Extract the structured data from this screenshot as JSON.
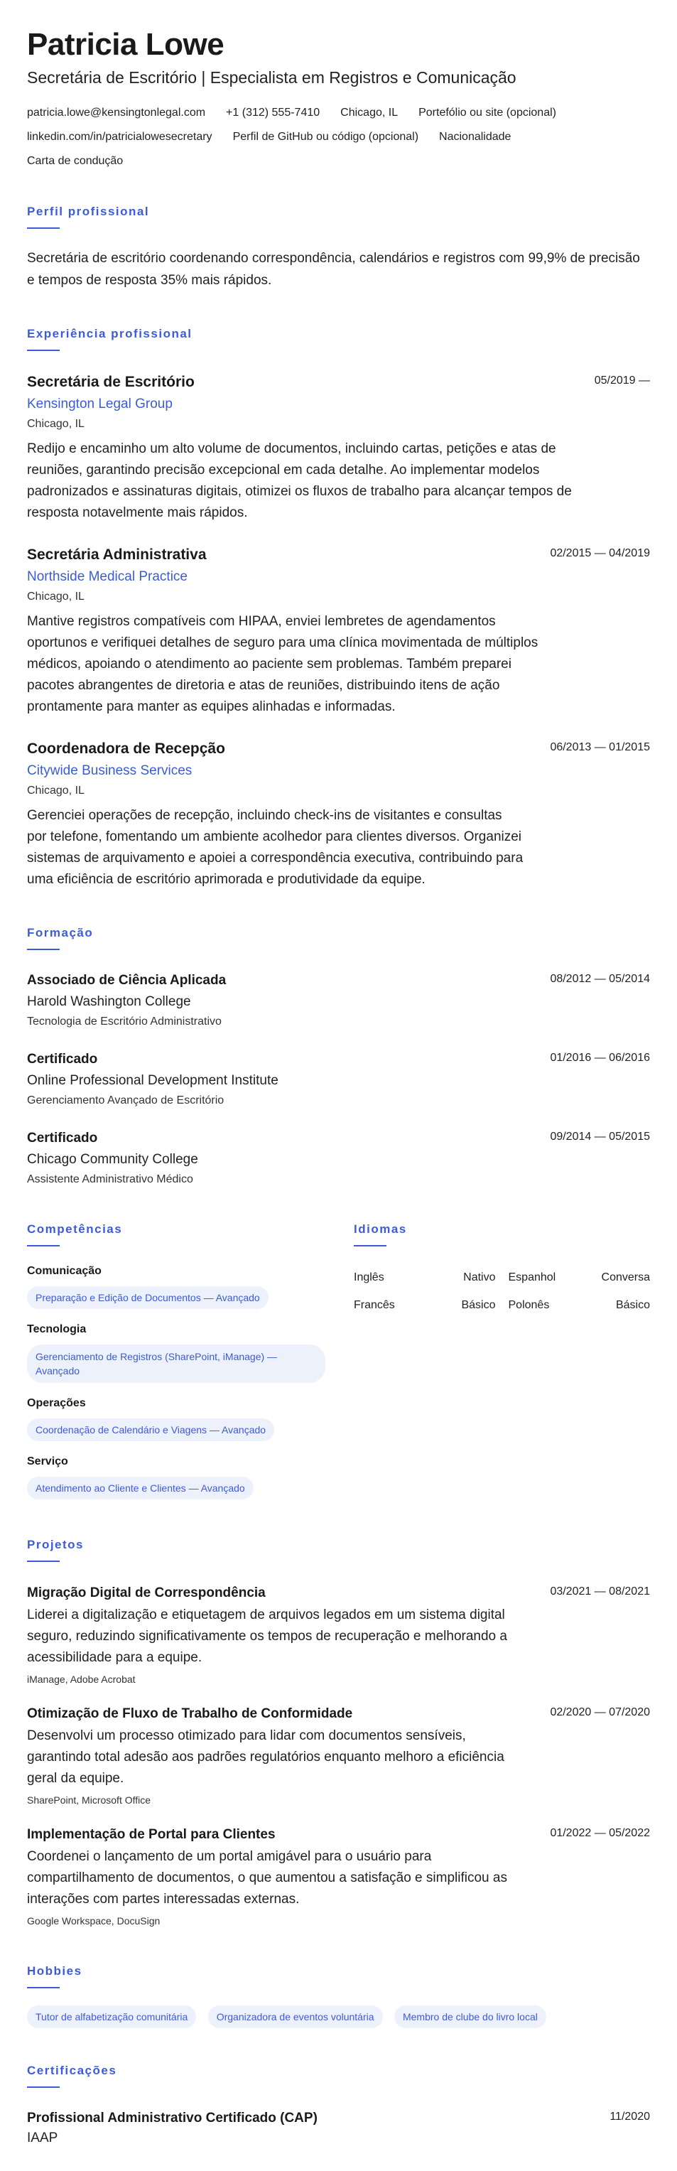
{
  "header": {
    "name": "Patricia Lowe",
    "headline": "Secretária de Escritório | Especialista em Registros e Comunicação",
    "contacts": [
      "patricia.lowe@kensingtonlegal.com",
      "+1 (312) 555-7410",
      "Chicago, IL",
      "Portefólio ou site (opcional)",
      "linkedin.com/in/patricialowesecretary",
      "Perfil de GitHub ou código (opcional)",
      "Nacionalidade",
      "Carta de condução"
    ]
  },
  "summary": {
    "title": "Perfil profissional",
    "text": "Secretária de escritório coordenando correspondência, calendários e registros com 99,9% de precisão e tempos de resposta 35% mais rápidos."
  },
  "experience": {
    "title": "Experiência profissional",
    "items": [
      {
        "role": "Secretária de Escritório",
        "company": "Kensington Legal Group",
        "location": "Chicago, IL",
        "dates": "05/2019 —",
        "description": "Redijo e encaminho um alto volume de documentos, incluindo cartas, petições e atas de reuniões, garantindo precisão excepcional em cada detalhe. Ao implementar modelos padronizados e assinaturas digitais, otimizei os fluxos de trabalho para alcançar tempos de resposta notavelmente mais rápidos."
      },
      {
        "role": "Secretária Administrativa",
        "company": "Northside Medical Practice",
        "location": "Chicago, IL",
        "dates": "02/2015 — 04/2019",
        "description": "Mantive registros compatíveis com HIPAA, enviei lembretes de agendamentos oportunos e verifiquei detalhes de seguro para uma clínica movimentada de múltiplos médicos, apoiando o atendimento ao paciente sem problemas. Também preparei pacotes abrangentes de diretoria e atas de reuniões, distribuindo itens de ação prontamente para manter as equipes alinhadas e informadas."
      },
      {
        "role": "Coordenadora de Recepção",
        "company": "Citywide Business Services",
        "location": "Chicago, IL",
        "dates": "06/2013 — 01/2015",
        "description": "Gerenciei operações de recepção, incluindo check-ins de visitantes e consultas por telefone, fomentando um ambiente acolhedor para clientes diversos. Organizei sistemas de arquivamento e apoiei a correspondência executiva, contribuindo para uma eficiência de escritório aprimorada e produtividade da equipe."
      }
    ]
  },
  "education": {
    "title": "Formação",
    "items": [
      {
        "degree": "Associado de Ciência Aplicada",
        "institution": "Harold Washington College",
        "field": "Tecnologia de Escritório Administrativo",
        "dates": "08/2012 — 05/2014"
      },
      {
        "degree": "Certificado",
        "institution": "Online Professional Development Institute",
        "field": "Gerenciamento Avançado de Escritório",
        "dates": "01/2016 — 06/2016"
      },
      {
        "degree": "Certificado",
        "institution": "Chicago Community College",
        "field": "Assistente Administrativo Médico",
        "dates": "09/2014 — 05/2015"
      }
    ]
  },
  "skills": {
    "title": "Competências",
    "groups": [
      {
        "name": "Comunicação",
        "pill": "Preparação e Edição de Documentos — Avançado"
      },
      {
        "name": "Tecnologia",
        "pill": "Gerenciamento de Registros (SharePoint, iManage) — Avançado"
      },
      {
        "name": "Operações",
        "pill": "Coordenação de Calendário e Viagens — Avançado"
      },
      {
        "name": "Serviço",
        "pill": "Atendimento ao Cliente e Clientes — Avançado"
      }
    ]
  },
  "languages": {
    "title": "Idiomas",
    "items": [
      {
        "language": "Inglês",
        "level": "Nativo"
      },
      {
        "language": "Espanhol",
        "level": "Conversa"
      },
      {
        "language": "Francês",
        "level": "Básico"
      },
      {
        "language": "Polonês",
        "level": "Básico"
      }
    ]
  },
  "projects": {
    "title": "Projetos",
    "items": [
      {
        "name": "Migração Digital de Correspondência",
        "dates": "03/2021 — 08/2021",
        "description": "Liderei a digitalização e etiquetagem de arquivos legados em um sistema digital seguro, reduzindo significativamente os tempos de recuperação e melhorando a acessibilidade para a equipe.",
        "tech": "iManage, Adobe Acrobat"
      },
      {
        "name": "Otimização de Fluxo de Trabalho de Conformidade",
        "dates": "02/2020 — 07/2020",
        "description": "Desenvolvi um processo otimizado para lidar com documentos sensíveis, garantindo total adesão aos padrões regulatórios enquanto melhoro a eficiência geral da equipe.",
        "tech": "SharePoint, Microsoft Office"
      },
      {
        "name": "Implementação de Portal para Clientes",
        "dates": "01/2022 — 05/2022",
        "description": "Coordenei o lançamento de um portal amigável para o usuário para compartilhamento de documentos, o que aumentou a satisfação e simplificou as interações com partes interessadas externas.",
        "tech": "Google Workspace, DocuSign"
      }
    ]
  },
  "hobbies": {
    "title": "Hobbies",
    "items": [
      "Tutor de alfabetização comunitária",
      "Organizadora de eventos voluntária",
      "Membro de clube do livro local"
    ]
  },
  "certifications": {
    "title": "Certificações",
    "items": [
      {
        "name": "Profissional Administrativo Certificado (CAP)",
        "issuer": "IAAP",
        "date": "11/2020"
      }
    ]
  }
}
